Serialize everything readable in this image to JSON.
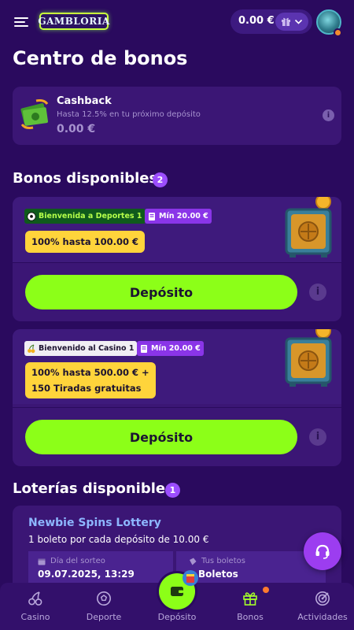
{
  "header": {
    "logo_text": "GAMBLORIA",
    "balance": "0.00 €"
  },
  "page_title": "Centro de bonos",
  "cashback": {
    "title": "Cashback",
    "subtitle": "Hasta 12.5% en tu próximo depósito",
    "amount": "0.00 €",
    "info": "i"
  },
  "bonuses": {
    "title": "Bonos disponibles",
    "count": "2",
    "items": [
      {
        "tag": "Bienvenida a Deportes 1",
        "min_tag": "Mín 20.00 €",
        "offer_line1": "100% hasta 100.00 €",
        "offer_line2": "",
        "button": "Depósito"
      },
      {
        "tag": "Bienvenido al Casino 1",
        "min_tag": "Mín 20.00 €",
        "offer_line1": "100% hasta 500.00 € +",
        "offer_line2": "150 Tiradas gratuitas",
        "button": "Depósito"
      }
    ]
  },
  "lotteries": {
    "title": "Loterías disponibles",
    "count": "1",
    "item": {
      "name": "Newbie Spins Lottery",
      "description": "1 boleto por cada depósito de 10.00 €",
      "draw_label": "Día del sorteo",
      "draw_value": "09.07.2025, 13:29",
      "tickets_label": "Tus boletos",
      "tickets_value": "Boletos"
    }
  },
  "nav": {
    "items": [
      {
        "label": "Casino",
        "icon": "cherry-icon"
      },
      {
        "label": "Deporte",
        "icon": "soccer-ball-icon"
      },
      {
        "label": "Depósito",
        "icon": "wallet-icon"
      },
      {
        "label": "Bonos",
        "icon": "gift-icon"
      },
      {
        "label": "Actividades",
        "icon": "target-icon"
      }
    ],
    "active": "Bonos"
  },
  "colors": {
    "background": "#2a0a5e",
    "card": "#3b1675",
    "accent_green": "#8cff18",
    "offer_yellow": "#ffd43b",
    "badge_purple": "#9c4dff"
  }
}
